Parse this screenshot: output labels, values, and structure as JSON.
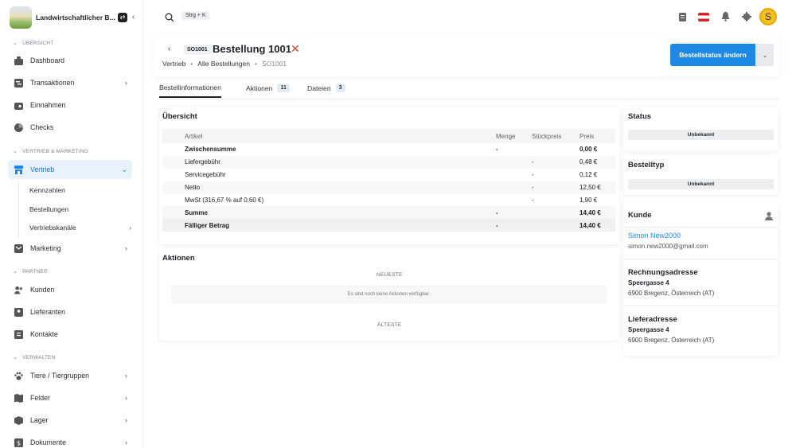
{
  "app": {
    "name": "Landwirtschaftlicher B..."
  },
  "search": {
    "shortcut": "Strg + K"
  },
  "sidebar": {
    "sections": [
      "ÜBERSICHT",
      "VERTRIEB & MARKETING",
      "PARTNER",
      "VERWALTEN"
    ],
    "items": [
      "Dashboard",
      "Transaktionen",
      "Einnahmen",
      "Checks",
      "Vertrieb",
      "Marketing",
      "Kunden",
      "Lieferanten",
      "Kontakte",
      "Tiere / Tiergruppen",
      "Felder",
      "Lager",
      "Dokumente"
    ],
    "sub_items": [
      "Kennzahlen",
      "Bestellungen",
      "Vertriebskanäle"
    ]
  },
  "user": {
    "initial": "S"
  },
  "header": {
    "badge": "SO1001",
    "title": "Bestellung 1001",
    "breadcrumb": [
      "Vertrieb",
      "Alle Bestellungen",
      "SO1001"
    ],
    "primary_button": "Bestellstatus ändern"
  },
  "tabs": [
    {
      "label": "Bestellinformationen"
    },
    {
      "label": "Aktionen",
      "count": "11"
    },
    {
      "label": "Dateien",
      "count": "3"
    }
  ],
  "overview": {
    "title": "Übersicht",
    "headers": [
      "Artikel",
      "Menge",
      "Stückpreis",
      "Preis"
    ],
    "rows": [
      [
        "Zwischensumme",
        "-",
        "",
        "0,00 €"
      ],
      [
        "Liefergebühr",
        "",
        "-",
        "0,48 €"
      ],
      [
        "Servicegebühr",
        "",
        "-",
        "0,12 €"
      ],
      [
        "Netto",
        "",
        "-",
        "12,50 €"
      ],
      [
        "MwSt (316,67 % auf 0,60 €)",
        "",
        "-",
        "1,90 €"
      ],
      [
        "Summe",
        "-",
        "",
        "14,40 €"
      ],
      [
        "Fälliger Betrag",
        "-",
        "",
        "14,40 €"
      ]
    ]
  },
  "actions": {
    "title": "Aktionen",
    "newest": "NEUESTE",
    "empty": "Es sind noch keine Aktionen verfügbar.",
    "oldest": "ÄLTESTE"
  },
  "status": {
    "title": "Status",
    "value": "Unbekannt"
  },
  "order_type": {
    "title": "Bestelltyp",
    "value": "Unbekannt"
  },
  "customer": {
    "title": "Kunde",
    "name": "Simon New2000",
    "email": "simon.new2000@gmail.com"
  },
  "billing": {
    "title": "Rechnungsadresse",
    "street": "Speergasse 4",
    "city": "6900 Bregenz, Österreich (AT)"
  },
  "shipping": {
    "title": "Lieferadresse",
    "street": "Speergasse 4",
    "city": "6900 Bregenz, Österreich (AT)"
  },
  "colors": {
    "accent": "#1e88e5",
    "active_bg": "#e8f2fd",
    "danger": "#d04a2b"
  }
}
